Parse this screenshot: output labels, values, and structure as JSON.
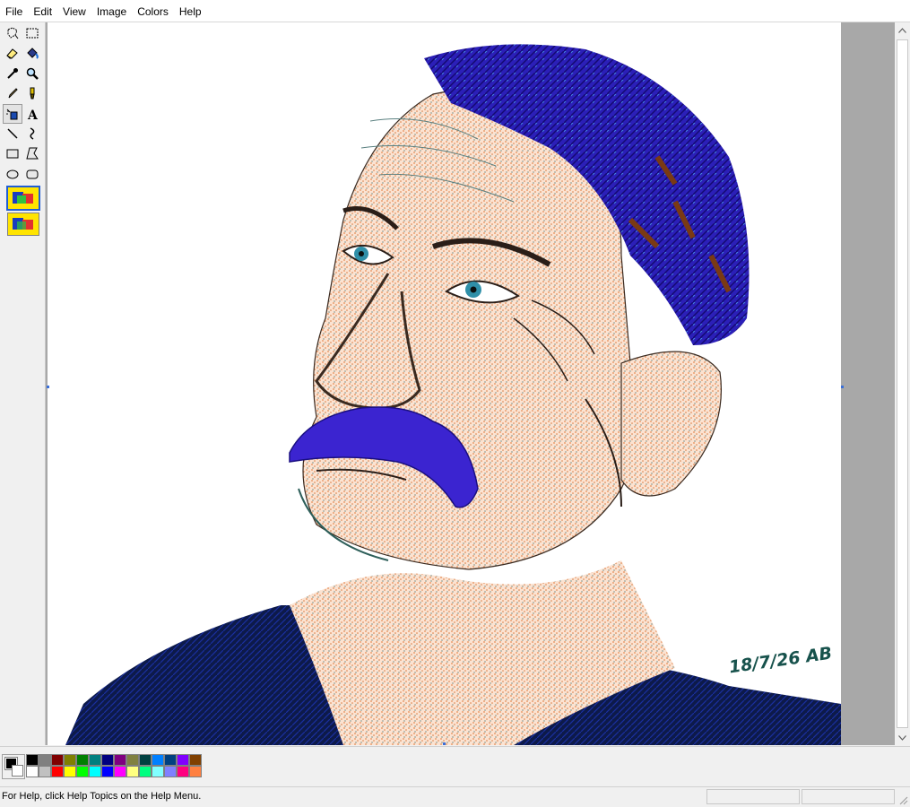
{
  "menu": {
    "items": [
      "File",
      "Edit",
      "View",
      "Image",
      "Colors",
      "Help"
    ]
  },
  "toolbox": {
    "tools": [
      "free-form-select-icon",
      "select-icon",
      "eraser-icon",
      "fill-icon",
      "pick-color-icon",
      "magnifier-icon",
      "pencil-icon",
      "brush-icon",
      "airbrush-icon",
      "text-icon",
      "line-icon",
      "curve-icon",
      "rectangle-icon",
      "polygon-icon",
      "ellipse-icon",
      "rounded-rectangle-icon"
    ],
    "active_tool": "airbrush-icon"
  },
  "canvas": {
    "signature": "18/7/26 AB"
  },
  "colors": {
    "foreground": "#000000",
    "background": "#ffffff",
    "palette": [
      "#000000",
      "#808080",
      "#800000",
      "#808000",
      "#008000",
      "#008080",
      "#000080",
      "#800080",
      "#808040",
      "#004040",
      "#0080ff",
      "#004080",
      "#8000ff",
      "#804000",
      "#ffffff",
      "#c0c0c0",
      "#ff0000",
      "#ffff00",
      "#00ff00",
      "#00ffff",
      "#0000ff",
      "#ff00ff",
      "#ffff80",
      "#00ff80",
      "#80ffff",
      "#8080ff",
      "#ff0080",
      "#ff8040"
    ]
  },
  "status": {
    "help_text": "For Help, click Help Topics on the Help Menu."
  }
}
